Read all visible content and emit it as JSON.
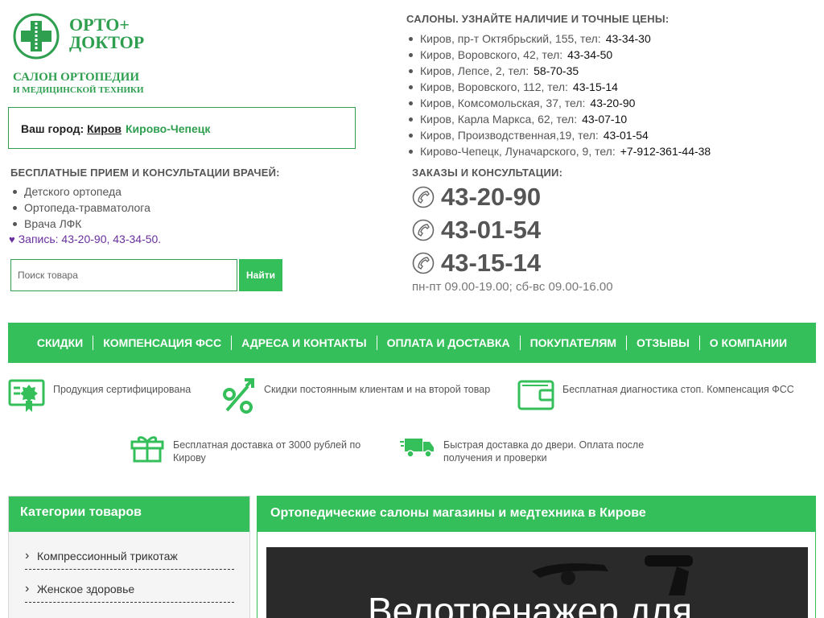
{
  "logo": {
    "name_line1": "ОРТО+",
    "name_line2": "ДОКТОР",
    "sub_line1": "САЛОН ОРТОПЕДИИ",
    "sub_line2": "И МЕДИЦИНСКОЙ ТЕХНИКИ"
  },
  "city": {
    "label": "Ваш город:",
    "current": "Киров",
    "other": "Кирово-Чепецк"
  },
  "consult": {
    "title": "БЕСПЛАТНЫЕ ПРИЕМ И КОНСУЛЬТАЦИИ ВРАЧЕЙ:",
    "doctors": [
      "Детского ортопеда",
      "Ортопеда-травматолога",
      "Врача ЛФК"
    ],
    "signup": "Запись: 43-20-90, 43-34-50."
  },
  "search": {
    "placeholder": "Поиск товара",
    "button": "Найти"
  },
  "salons": {
    "title": "САЛОНЫ. УЗНАЙТЕ НАЛИЧИЕ И ТОЧНЫЕ ЦЕНЫ:",
    "items": [
      {
        "address": "Киров, пр-т Октябрьский, 155, тел:",
        "phone": "43-34-30"
      },
      {
        "address": "Киров, Воровского, 42, тел:",
        "phone": "43-34-50"
      },
      {
        "address": "Киров, Лепсе, 2, тел:",
        "phone": "58-70-35"
      },
      {
        "address": "Киров, Воровского, 112, тел:",
        "phone": "43-15-14"
      },
      {
        "address": "Киров, Комсомольская, 37, тел:",
        "phone": "43-20-90"
      },
      {
        "address": "Киров, Карла Маркса, 62, тел:",
        "phone": "43-07-10"
      },
      {
        "address": "Киров, Производственная,19, тел:",
        "phone": "43-01-54"
      },
      {
        "address": "Кирово-Чепецк, Луначарского, 9, тел:",
        "phone": "+7-912-361-44-38"
      }
    ]
  },
  "orders": {
    "title": "ЗАКАЗЫ И КОНСУЛЬТАЦИИ:",
    "phones": [
      "43-20-90",
      "43-01-54",
      "43-15-14"
    ],
    "hours": "пн-пт 09.00-19.00; сб-вс 09.00-16.00"
  },
  "nav": [
    "СКИДКИ",
    "КОМПЕНСАЦИЯ ФСС",
    "АДРЕСА И КОНТАКТЫ",
    "ОПЛАТА И ДОСТАВКА",
    "ПОКУПАТЕЛЯМ",
    "ОТЗЫВЫ",
    "О КОМПАНИИ"
  ],
  "features": [
    {
      "icon": "certificate-icon",
      "text": "Продукция сертифицирована"
    },
    {
      "icon": "percent-icon",
      "text": "Скидки постоянным клиентам и на второй товар"
    },
    {
      "icon": "wallet-icon",
      "text": "Бесплатная диагностика стоп. Компенсация ФСС"
    },
    {
      "icon": "gift-icon",
      "text_line1": "Бесплатная доставка от 3000 рублей по",
      "text_line2": "Кирову"
    },
    {
      "icon": "truck-icon",
      "text_line1": "Быстрая доставка до двери. Оплата после",
      "text_line2": "получения и проверки"
    }
  ],
  "sidebar": {
    "title": "Категории товаров",
    "items": [
      "Компрессионный трикотаж",
      "Женское здоровье"
    ]
  },
  "main": {
    "title": "Ортопедические салоны магазины и медтехника в Кирове",
    "banner_text": "Велотренажер для"
  },
  "colors": {
    "brand_green": "#35bf5a",
    "logo_green": "#2e9e4f",
    "signup_purple": "#6a2f9e"
  }
}
